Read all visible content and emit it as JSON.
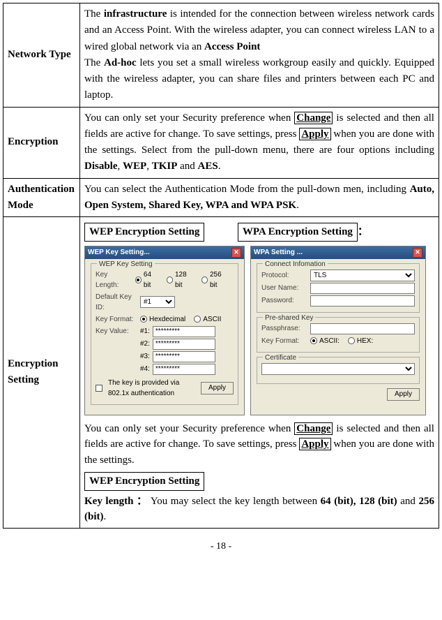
{
  "rows": {
    "network_type": {
      "label": "Network Type",
      "text": {
        "t1": "The ",
        "b1": "infrastructure",
        "t2": " is intended for the connection between wireless network cards and an Access Point. With the wireless adapter, you can connect wireless LAN to a wired global network via an ",
        "b2": "Access Point",
        "t3": "The ",
        "b3": "Ad-hoc",
        "t4": " lets you set a small wireless workgroup easily and quickly.   Equipped with the wireless adapter, you can share files and printers between each PC and laptop."
      }
    },
    "encryption": {
      "label": "Encryption",
      "text": {
        "t1": "You can only set your Security preference when ",
        "btn1": "Change",
        "t2": " is selected and then all fields are active for change. To save settings, press ",
        "btn2": "Apply",
        "t3": " when you are done with the settings. Select from the pull-down menu, there are four options including ",
        "b1": "Disable",
        "sep": ", ",
        "b2": "WEP",
        "b3": "TKIP",
        "and": " and ",
        "b4": "AES",
        "dot": "."
      }
    },
    "auth_mode": {
      "label": "Authentication Mode",
      "text": {
        "t1": "You can select the Authentication Mode from the pull-down men, including ",
        "b1": "Auto, Open System, Shared Key, WPA and WPA PSK",
        "dot": "."
      }
    },
    "enc_setting": {
      "label": "Encryption Setting",
      "wep_heading": "WEP Encryption Setting",
      "wpa_heading": "WPA Encryption Setting",
      "colon": "：",
      "desc": {
        "t1": "You can only set your Security preference when ",
        "btn1": "Change",
        "t2": " is selected and then all fields are active for change. To save settings, press ",
        "btn2": "Apply",
        "t3": " when you are done with the settings."
      },
      "wep_heading2": "WEP Encryption Setting",
      "key_len": {
        "lead": "Key length  ",
        "colon2": "：",
        "t1": " You may select the key length between ",
        "b1": "64 (bit), 128 (bit)",
        "and": " and ",
        "b2": "256 (bit)",
        "dot": "."
      }
    }
  },
  "wep_dlg": {
    "title": "WEP Key Setting...",
    "grp_title": "WEP Key Setting",
    "rows": {
      "key_length": {
        "label": "Key Length:",
        "opt64": "64 bit",
        "opt128": "128 bit",
        "opt256": "256 bit"
      },
      "default_key": {
        "label": "Default Key ID:",
        "value": "#1"
      },
      "key_format": {
        "label": "Key Format:",
        "hex": "Hexdecimal",
        "asc": "ASCII"
      },
      "key_value": {
        "label": "Key Value:",
        "k1": "#1:",
        "k2": "#2:",
        "k3": "#3:",
        "k4": "#4:",
        "mask": "*********"
      },
      "provided": "The key is provided via 802.1x authentication"
    },
    "apply": "Apply"
  },
  "wpa_dlg": {
    "title": "WPA Setting ...",
    "grp1": {
      "title": "Connect Infomation",
      "protocol": {
        "label": "Protocol:",
        "value": "TLS"
      },
      "username": {
        "label": "User Name:"
      },
      "password": {
        "label": "Password:"
      }
    },
    "grp2": {
      "title": "Pre-shared Key",
      "pass": {
        "label": "Passphrase:"
      },
      "fmt": {
        "label": "Key Format:",
        "asc": "ASCII:",
        "hex": "HEX:"
      }
    },
    "grp3": {
      "title": "Certificate"
    },
    "apply": "Apply"
  },
  "page": "- 18 -"
}
